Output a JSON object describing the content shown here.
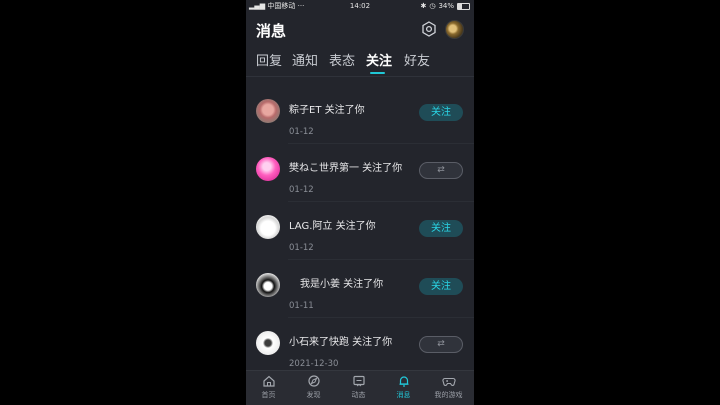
{
  "status": {
    "carrier": "中国移动",
    "time": "14:02",
    "battery": "34%"
  },
  "header": {
    "title": "消息"
  },
  "tabs": [
    {
      "label": "回复",
      "active": false
    },
    {
      "label": "通知",
      "active": false
    },
    {
      "label": "表态",
      "active": false
    },
    {
      "label": "关注",
      "active": true
    },
    {
      "label": "好友",
      "active": false
    }
  ],
  "items": [
    {
      "name": "粽子ET 关注了你",
      "date": "01-12",
      "button": "关注",
      "button_type": "follow"
    },
    {
      "name": "樊ねこ世界第一 关注了你",
      "date": "01-12",
      "button": "⇄",
      "button_type": "mutual"
    },
    {
      "name": "LAG.阿立 关注了你",
      "date": "01-12",
      "button": "关注",
      "button_type": "follow"
    },
    {
      "name": "我是小姜 关注了你",
      "date": "01-11",
      "button": "关注",
      "button_type": "follow"
    },
    {
      "name": "小石来了快跑 关注了你",
      "date": "2021-12-30",
      "button": "⇄",
      "button_type": "mutual"
    }
  ],
  "bottom_nav": [
    {
      "label": "首页",
      "icon": "home-icon",
      "active": false
    },
    {
      "label": "发现",
      "icon": "discover-icon",
      "active": false
    },
    {
      "label": "动态",
      "icon": "feed-icon",
      "active": false
    },
    {
      "label": "消息",
      "icon": "bell-icon",
      "active": true
    },
    {
      "label": "我的游戏",
      "icon": "gamepad-icon",
      "active": false
    }
  ],
  "colors": {
    "accent": "#20c7d6",
    "background": "#23252c"
  }
}
